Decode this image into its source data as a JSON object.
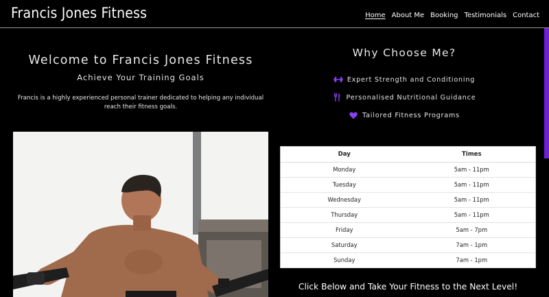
{
  "brand": "Francis Jones Fitness",
  "nav": [
    {
      "label": "Home",
      "active": true
    },
    {
      "label": "About Me",
      "active": false
    },
    {
      "label": "Booking",
      "active": false
    },
    {
      "label": "Testimonials",
      "active": false
    },
    {
      "label": "Contact",
      "active": false
    }
  ],
  "welcome": {
    "title": "Welcome to Francis Jones Fitness",
    "subtitle": "Achieve Your Training Goals",
    "description": "Francis is a highly experienced personal trainer dedicated to helping any individual reach their fitness goals."
  },
  "why": {
    "title": "Why Choose Me?",
    "features": [
      {
        "icon": "dumbbell-icon",
        "label": "Expert Strength and Conditioning"
      },
      {
        "icon": "utensils-icon",
        "label": "Personalised Nutritional Guidance"
      },
      {
        "icon": "heart-icon",
        "label": "Tailored Fitness Programs"
      }
    ]
  },
  "schedule": {
    "headers": [
      "Day",
      "Times"
    ],
    "rows": [
      [
        "Monday",
        "5am - 11pm"
      ],
      [
        "Tuesday",
        "5am - 11pm"
      ],
      [
        "Wednesday",
        "5am - 11pm"
      ],
      [
        "Thursday",
        "5am - 11pm"
      ],
      [
        "Friday",
        "5am - 7pm"
      ],
      [
        "Saturday",
        "7am - 1pm"
      ],
      [
        "Sunday",
        "7am - 1pm"
      ]
    ]
  },
  "cta": "Click Below and Take Your Fitness to the Next Level!",
  "colors": {
    "accent": "#6f1fd6",
    "background": "#000000"
  }
}
